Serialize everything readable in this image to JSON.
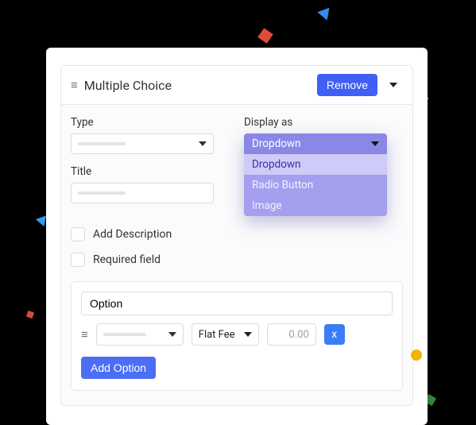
{
  "header": {
    "title": "Multiple Choice",
    "remove_label": "Remove"
  },
  "fields": {
    "type_label": "Type",
    "display_as_label": "Display as",
    "title_label": "Title",
    "add_description_label": "Add Description",
    "required_label": "Required field"
  },
  "display_as": {
    "selected": "Dropdown",
    "options": [
      "Dropdown",
      "Radio Button",
      "Image"
    ],
    "highlighted_index": 0
  },
  "option_row": {
    "option_value": "Option",
    "fee_label": "Flat Fee",
    "fee_amount": "0.00",
    "remove_glyph": "x"
  },
  "buttons": {
    "add_option": "Add Option"
  }
}
